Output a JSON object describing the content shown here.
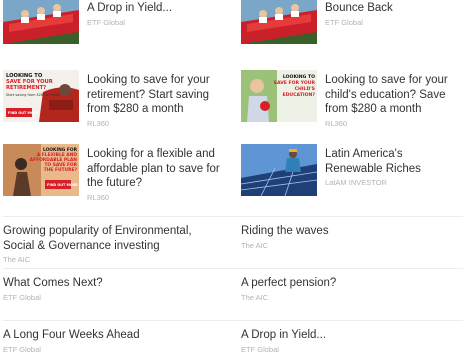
{
  "thumb_cards": [
    {
      "title": "A Drop in Yield...",
      "source": "ETF Global",
      "thumb": "coaster-icon"
    },
    {
      "title": "Bounce Back",
      "source": "ETF Global",
      "thumb": "coaster-icon"
    },
    {
      "title": "Looking to save for your retirement? Start saving from $280 a month",
      "source": "RL360",
      "thumb": "retirement-ad-icon",
      "ad": {
        "line1": "LOOKING TO",
        "line2": "SAVE FOR YOUR",
        "line3": "RETIREMENT?",
        "small": "Start saving from $280 a month",
        "cta": "FIND OUT MORE"
      }
    },
    {
      "title": "Looking to save for your child's education? Save from $280 a month",
      "source": "RL360",
      "thumb": "education-ad-icon",
      "ad": {
        "line1": "LOOKING TO",
        "line2": "SAVE FOR YOUR",
        "line3": "CHILD'S",
        "line4": "EDUCATION?"
      }
    },
    {
      "title": "Looking for a flexible and affordable plan to save for the future?",
      "source": "RL360",
      "thumb": "flexible-plan-ad-icon",
      "ad": {
        "line1": "LOOKING FOR",
        "line2": "A FLEXIBLE AND",
        "line3": "AFFORDABLE PLAN",
        "line4": "TO SAVE FOR",
        "line5": "THE FUTURE?",
        "cta": "FIND OUT MORE"
      }
    },
    {
      "title": "Latin America's Renewable Riches",
      "source": "LatAM INVESTOR",
      "thumb": "solar-worker-icon"
    }
  ],
  "text_items": [
    {
      "title": "Growing popularity of Environmental, Social & Governance investing",
      "source": "The AIC"
    },
    {
      "title": "Riding the waves",
      "source": "The AIC"
    },
    {
      "title": "What Comes Next?",
      "source": "ETF Global"
    },
    {
      "title": "A perfect pension?",
      "source": "The AIC"
    },
    {
      "title": "A Long Four Weeks Ahead",
      "source": "ETF Global"
    },
    {
      "title": "A Drop in Yield...",
      "source": "ETF Global"
    }
  ],
  "colors": {
    "accent": "#d61f26",
    "text": "#333333",
    "source": "#b3b3b3",
    "divider": "#ececec"
  }
}
